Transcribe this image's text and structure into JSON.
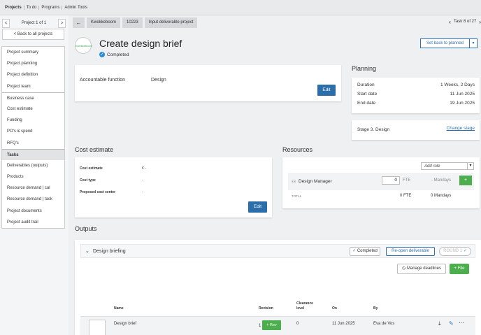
{
  "topnav": {
    "items": [
      "Projects",
      "To do",
      "Programs",
      "Admin Tools"
    ],
    "active": "Projects"
  },
  "sidebar": {
    "pager": {
      "prev": "<",
      "label": "Project 1 of 1",
      "next": ">"
    },
    "back_label": "< Back to all projects",
    "group1": [
      "Project summary",
      "Project planning",
      "Project definition",
      "Project team"
    ],
    "group2": [
      "Business case",
      "Cost estimate",
      "Funding",
      "PO's & spend",
      "RFQ's"
    ],
    "group3": [
      "Tasks",
      "Deliverables (outputs)",
      "Products",
      "Resource demand | cal",
      "Resource demand | task",
      "Project documents",
      "Project audit trail"
    ],
    "active": "Tasks"
  },
  "breadcrumbs": {
    "back": "←",
    "items": [
      "Kwekkeboom",
      "10223",
      "Input deliverable project"
    ]
  },
  "tasknav": {
    "prev": "‹",
    "label": "Task 8 of 27",
    "next": "›"
  },
  "header": {
    "logo_text": "Kwekkeboom",
    "title": "Create design brief",
    "status": "Completed",
    "set_back": "Set back to planned",
    "dropdown": "▾"
  },
  "accountable": {
    "label": "Accountable function",
    "value": "Design",
    "edit": "Edit"
  },
  "planning": {
    "title": "Planning",
    "rows": [
      {
        "label": "Duration",
        "value": "1 Weeks, 2 Days"
      },
      {
        "label": "Start date",
        "value": "11 Jun 2025"
      },
      {
        "label": "End date",
        "value": "19 Jun 2025"
      }
    ]
  },
  "stage": {
    "label": "Stage 3. Design",
    "link": "Change stage"
  },
  "cost": {
    "title": "Cost estimate",
    "rows": [
      {
        "label": "Cost estimate",
        "value": "€ -"
      },
      {
        "label": "Cost type",
        "value": "-"
      },
      {
        "label": "Proposed cost center",
        "value": "-"
      }
    ],
    "edit": "Edit"
  },
  "resources": {
    "title": "Resources",
    "add_role": "Add role",
    "role": {
      "name": "Design Manager",
      "fte_value": "0",
      "fte_label": "FTE",
      "mandays": "- Mandays",
      "add": "+"
    },
    "total": {
      "label": "TOTAL",
      "fte": "0 FTE",
      "mandays": "0 Mandays"
    }
  },
  "outputs": {
    "title": "Outputs",
    "deliverable": "Design briefing",
    "status": "Completed",
    "reopen": "Re-open deliverable",
    "round": "ROUND 1",
    "manage": "Manage deadlines",
    "add_file": "+ File",
    "columns": [
      "Name",
      "Revision",
      "Clearance level",
      "On",
      "By"
    ],
    "file": {
      "name": "Design brief",
      "revision": "1",
      "rev_btn": "+ Rev",
      "clearance": "0",
      "on": "11 Jun 2025",
      "by": "Eva de Vos"
    }
  }
}
